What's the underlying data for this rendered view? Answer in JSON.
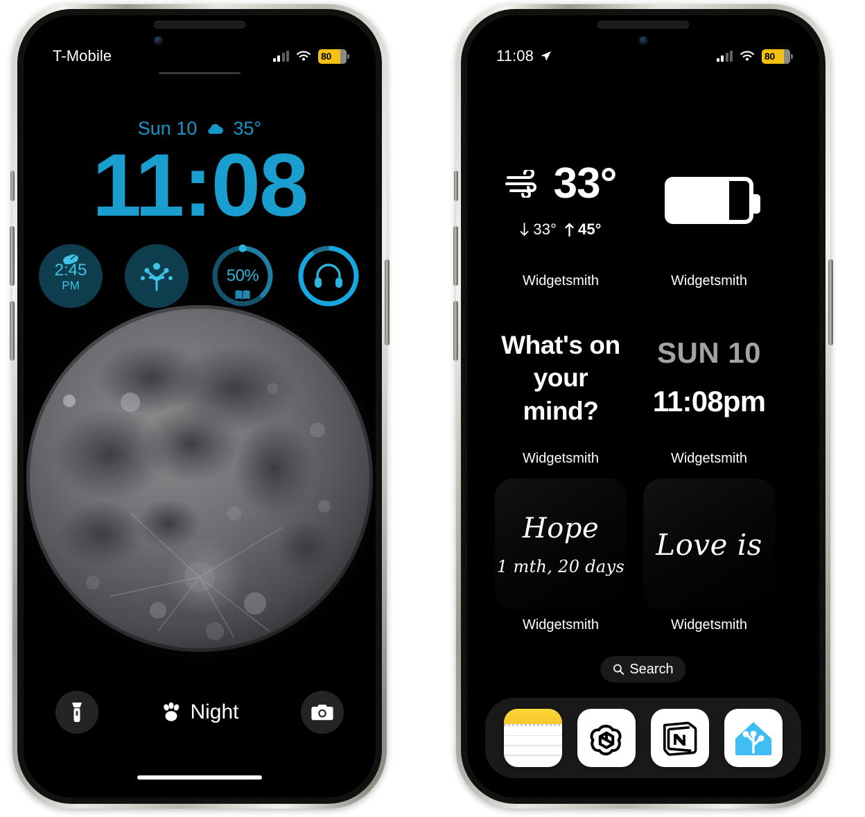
{
  "colors": {
    "lock_accent": "#1a9ed0",
    "widget_fill": "#0e3d4e",
    "battery_yellow": "#f3c113",
    "home_assistant_blue": "#41bdf5",
    "notes_yellow": "#fcd838"
  },
  "lock_screen": {
    "status_bar": {
      "carrier": "T-Mobile",
      "battery_level": "80",
      "signal_icon": "cellular-signal-icon",
      "wifi_icon": "wifi-icon",
      "battery_icon": "battery-icon"
    },
    "date": "Sun 10",
    "weather_icon": "cloud-icon",
    "temperature": "35°",
    "time": "11:08",
    "widgets": [
      {
        "name": "medication-widget",
        "icon": "pill-icon",
        "time": "2:45",
        "ampm": "PM"
      },
      {
        "name": "plant-widget",
        "icon": "sprout-icon"
      },
      {
        "name": "reading-progress-widget",
        "value": "50%",
        "icon": "book-icon",
        "progress": 50
      },
      {
        "name": "headphones-battery-widget",
        "icon": "headphones-icon",
        "progress": 88
      }
    ],
    "wallpaper": "full-moon-photo",
    "bottom": {
      "flashlight_icon": "flashlight-icon",
      "camera_icon": "camera-icon",
      "focus_icon": "paw-print-icon",
      "focus_label": "Night"
    }
  },
  "home_screen": {
    "status_bar": {
      "time": "11:08",
      "location_icon": "location-arrow-icon",
      "battery_level": "80",
      "signal_icon": "cellular-signal-icon",
      "wifi_icon": "wifi-icon",
      "battery_icon": "battery-icon"
    },
    "widgets": [
      {
        "name": "weather-widget",
        "icon": "wind-icon",
        "temperature": "33°",
        "low_label": "33°",
        "high_label": "45°",
        "low_icon": "arrow-down-icon",
        "high_icon": "arrow-up-icon",
        "app_label": "Widgetsmith"
      },
      {
        "name": "battery-widget",
        "icon": "battery-large-icon",
        "battery_percent": 75,
        "app_label": "Widgetsmith"
      },
      {
        "name": "notes-prompt-widget",
        "line1": "What's on",
        "line2": "your mind?",
        "app_label": "Widgetsmith"
      },
      {
        "name": "date-time-widget",
        "date": "SUN 10",
        "time": "11:08pm",
        "app_label": "Widgetsmith"
      },
      {
        "name": "countdown-hope-widget",
        "title": "Hope",
        "subtitle": "1 mth, 20 days",
        "app_label": "Widgetsmith"
      },
      {
        "name": "countdown-love-widget",
        "title": "Love is",
        "app_label": "Widgetsmith"
      }
    ],
    "search": {
      "label": "Search",
      "icon": "magnifier-icon"
    },
    "dock": [
      {
        "name": "notes-app",
        "label": "Notes",
        "icon": "notes-icon"
      },
      {
        "name": "chatgpt-app",
        "label": "ChatGPT",
        "icon": "openai-icon"
      },
      {
        "name": "notion-app",
        "label": "Notion",
        "icon": "notion-icon"
      },
      {
        "name": "home-assistant-app",
        "label": "Home Assistant",
        "icon": "home-assistant-icon"
      }
    ]
  }
}
